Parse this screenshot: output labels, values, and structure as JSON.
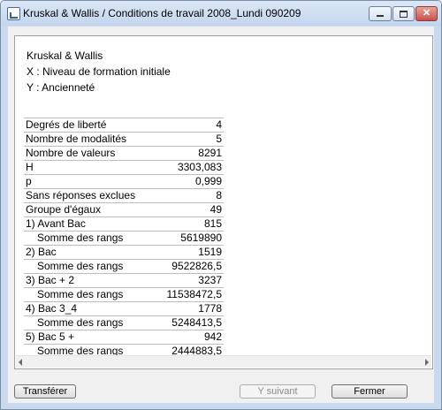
{
  "window": {
    "title": "Kruskal & Wallis / Conditions de travail 2008_Lundi 090209"
  },
  "header": {
    "test_name": "Kruskal & Wallis",
    "x_line": "X : Niveau de formation initiale",
    "y_line": "Y : Ancienneté"
  },
  "stats": [
    {
      "label": "Degrés de liberté",
      "value": "4"
    },
    {
      "label": "Nombre de modalités",
      "value": "5"
    },
    {
      "label": "Nombre de valeurs",
      "value": "8291"
    },
    {
      "label": "H",
      "value": "3303,083"
    },
    {
      "label": "p",
      "value": "0,999"
    },
    {
      "label": "Sans réponses exclues",
      "value": "8"
    },
    {
      "label": "Groupe d'égaux",
      "value": "49"
    },
    {
      "label": "1) Avant Bac",
      "value": "815"
    },
    {
      "label": "Somme des rangs",
      "value": "5619890"
    },
    {
      "label": "2) Bac",
      "value": "1519"
    },
    {
      "label": "Somme des rangs",
      "value": "9522826,5"
    },
    {
      "label": "3) Bac + 2",
      "value": "3237"
    },
    {
      "label": "Somme des rangs",
      "value": "11538472,5"
    },
    {
      "label": "4) Bac 3_4",
      "value": "1778"
    },
    {
      "label": "Somme des rangs",
      "value": "5248413,5"
    },
    {
      "label": "5) Bac 5 +",
      "value": "942"
    },
    {
      "label": "Somme des rangs",
      "value": "2444883,5"
    }
  ],
  "buttons": {
    "transfer": "Transférer",
    "y_next": "Y suivant",
    "close": "Fermer"
  }
}
